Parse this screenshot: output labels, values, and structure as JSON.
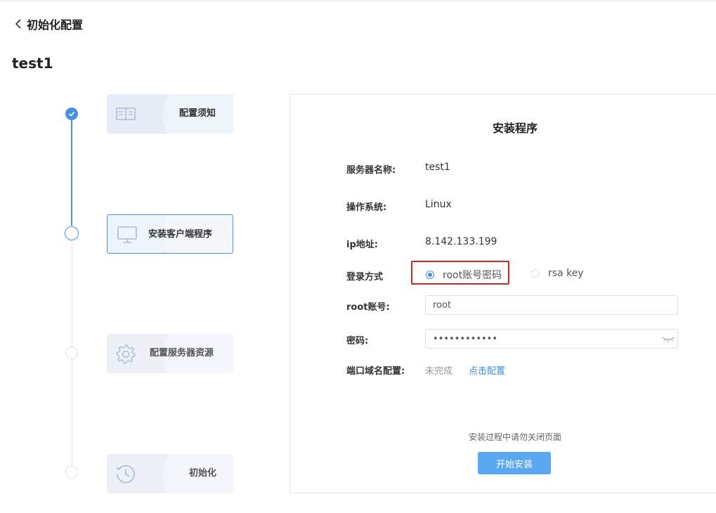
{
  "header": {
    "back_title": "初始化配置",
    "page_title": "test1"
  },
  "steps": [
    {
      "label": "配置须知",
      "icon": "book-icon",
      "state": "done"
    },
    {
      "label": "安装客户端程序",
      "icon": "monitor-icon",
      "state": "current"
    },
    {
      "label": "配置服务器资源",
      "icon": "gear-icon",
      "state": "pending"
    },
    {
      "label": "初始化",
      "icon": "clock-icon",
      "state": "pending"
    }
  ],
  "panel": {
    "title": "安装程序",
    "server_name_label": "服务器名称:",
    "server_name_value": "test1",
    "os_label": "操作系统:",
    "os_value": "Linux",
    "ip_label": "ip地址:",
    "ip_value": "8.142.133.199",
    "login_label": "登录方式",
    "login_options": [
      {
        "label": "root账号密码",
        "selected": true
      },
      {
        "label": "rsa key",
        "selected": false
      }
    ],
    "root_account_label": "root账号:",
    "root_account_value": "root",
    "password_label": "密码:",
    "password_value": "••••••••••••",
    "port_label": "端口域名配置:",
    "port_status": "未完成",
    "port_link": "点击配置",
    "note": "安装过程中请勿关闭页面",
    "start_button": "开始安装"
  },
  "colors": {
    "accent": "#4a90e2",
    "button": "#5aa9f0",
    "highlight": "#e02020",
    "link": "#3a8ee6"
  }
}
